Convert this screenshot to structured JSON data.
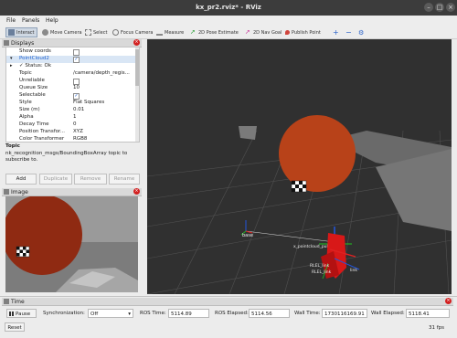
{
  "window": {
    "title": "kx_pr2.rviz* - RViz"
  },
  "menu": [
    "File",
    "Panels",
    "Help"
  ],
  "toolbar": [
    {
      "label": "Interact",
      "icon": "interact-icon",
      "active": true
    },
    {
      "label": "Move Camera",
      "icon": "move-camera-icon"
    },
    {
      "label": "Select",
      "icon": "select-icon"
    },
    {
      "label": "Focus Camera",
      "icon": "focus-camera-icon"
    },
    {
      "label": "Measure",
      "icon": "measure-icon"
    },
    {
      "label": "2D Pose Estimate",
      "icon": "pose-estimate-icon"
    },
    {
      "label": "2D Nav Goal",
      "icon": "nav-goal-icon"
    },
    {
      "label": "Publish Point",
      "icon": "publish-point-icon"
    }
  ],
  "displays_panel": {
    "title": "Displays",
    "rows": [
      {
        "key": "Show coords",
        "type": "check",
        "checked": false
      },
      {
        "key": "PointCloud2",
        "type": "check",
        "checked": true,
        "selected": true,
        "arrow": "▾"
      },
      {
        "key": "✓ Status: Ok",
        "type": "text",
        "value": "",
        "arrow": "▸"
      },
      {
        "key": "Topic",
        "value": "/camera/depth_regis..."
      },
      {
        "key": "Unreliable",
        "type": "check",
        "checked": false
      },
      {
        "key": "Queue Size",
        "value": "10"
      },
      {
        "key": "Selectable",
        "type": "check",
        "checked": true
      },
      {
        "key": "Style",
        "value": "Flat Squares"
      },
      {
        "key": "Size (m)",
        "value": "0.01"
      },
      {
        "key": "Alpha",
        "value": "1"
      },
      {
        "key": "Decay Time",
        "value": "0"
      },
      {
        "key": "Position Transfor...",
        "value": "XYZ"
      },
      {
        "key": "Color Transformer",
        "value": "RGB8"
      }
    ],
    "topic_title": "Topic",
    "topic_desc": "nk_recognition_msgs/BoundingBoxArray topic to subscribe to.",
    "buttons": [
      {
        "label": "Add",
        "enabled": true
      },
      {
        "label": "Duplicate",
        "enabled": false
      },
      {
        "label": "Remove",
        "enabled": false
      },
      {
        "label": "Rename",
        "enabled": false
      }
    ]
  },
  "image_panel": {
    "title": "Image"
  },
  "scene_labels": {
    "base": "base",
    "pointcloud_label": "x_pointcloud_publisher",
    "marker_labels": [
      "RLEL_link",
      "RLEL_link",
      "link"
    ]
  },
  "time_panel": {
    "title": "Time",
    "pause_label": "Pause",
    "sync_label": "Synchronization:",
    "sync_value": "Off",
    "ros_time_label": "ROS Time:",
    "ros_time": "5114.89",
    "ros_elapsed_label": "ROS Elapsed:",
    "ros_elapsed": "5114.56",
    "wall_time_label": "Wall Time:",
    "wall_time": "1730116169.91",
    "wall_elapsed_label": "Wall Elapsed:",
    "wall_elapsed": "5118.41",
    "reset_label": "Reset",
    "fps": "31 fps"
  }
}
